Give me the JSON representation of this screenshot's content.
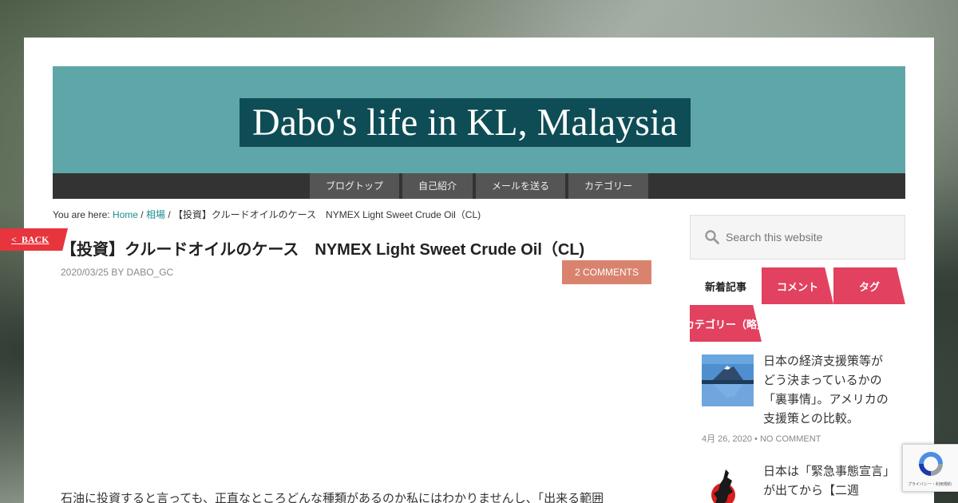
{
  "site": {
    "title": "Dabo's life in KL, Malaysia"
  },
  "nav": {
    "items": [
      "ブログトップ",
      "自己紹介",
      "メールを送る",
      "カテゴリー"
    ]
  },
  "breadcrumb": {
    "prefix": "You are here: ",
    "home": "Home",
    "sep1": " / ",
    "category": "相場",
    "sep2": " / ",
    "current": "【投資】クルードオイルのケース　NYMEX Light Sweet Crude Oil（CL)"
  },
  "back_button": {
    "arrow": "<",
    "label": "BACK"
  },
  "post": {
    "title": "【投資】クルードオイルのケース　NYMEX Light Sweet Crude Oil（CL)",
    "meta": "2020/03/25 BY DABO_GC",
    "comments": "2 COMMENTS",
    "body_start": "石油に投資すると言っても、正直なところどんな種類があるのか私にはわかりませんし、「出来る範囲"
  },
  "search": {
    "placeholder": "Search this website"
  },
  "tabs": [
    {
      "label": "新着記事",
      "active": true
    },
    {
      "label": "コメント",
      "active": false
    },
    {
      "label": "タグ",
      "active": false
    },
    {
      "label": "カテゴリー（略）",
      "active": false
    }
  ],
  "articles": [
    {
      "title": "日本の経済支援策等がどう決まっているかの「裏事情」。アメリカの支援策との比較。",
      "date": "4月 26, 2020",
      "bullet": " • ",
      "comments": "NO COMMENT"
    },
    {
      "title": "日本は「緊急事態宣言」が出てから【二週",
      "date": "",
      "bullet": "",
      "comments": ""
    }
  ],
  "recaptcha": {
    "footer": "プライバシー・利用規約"
  },
  "colors": {
    "header_bg": "#5fa6a8",
    "title_bg": "#0e4d55",
    "nav_bg": "#333333",
    "accent_pink": "#e2415f",
    "back_red": "#e8343d",
    "comments_bg": "#d9836f",
    "link": "#1b8f8f"
  }
}
